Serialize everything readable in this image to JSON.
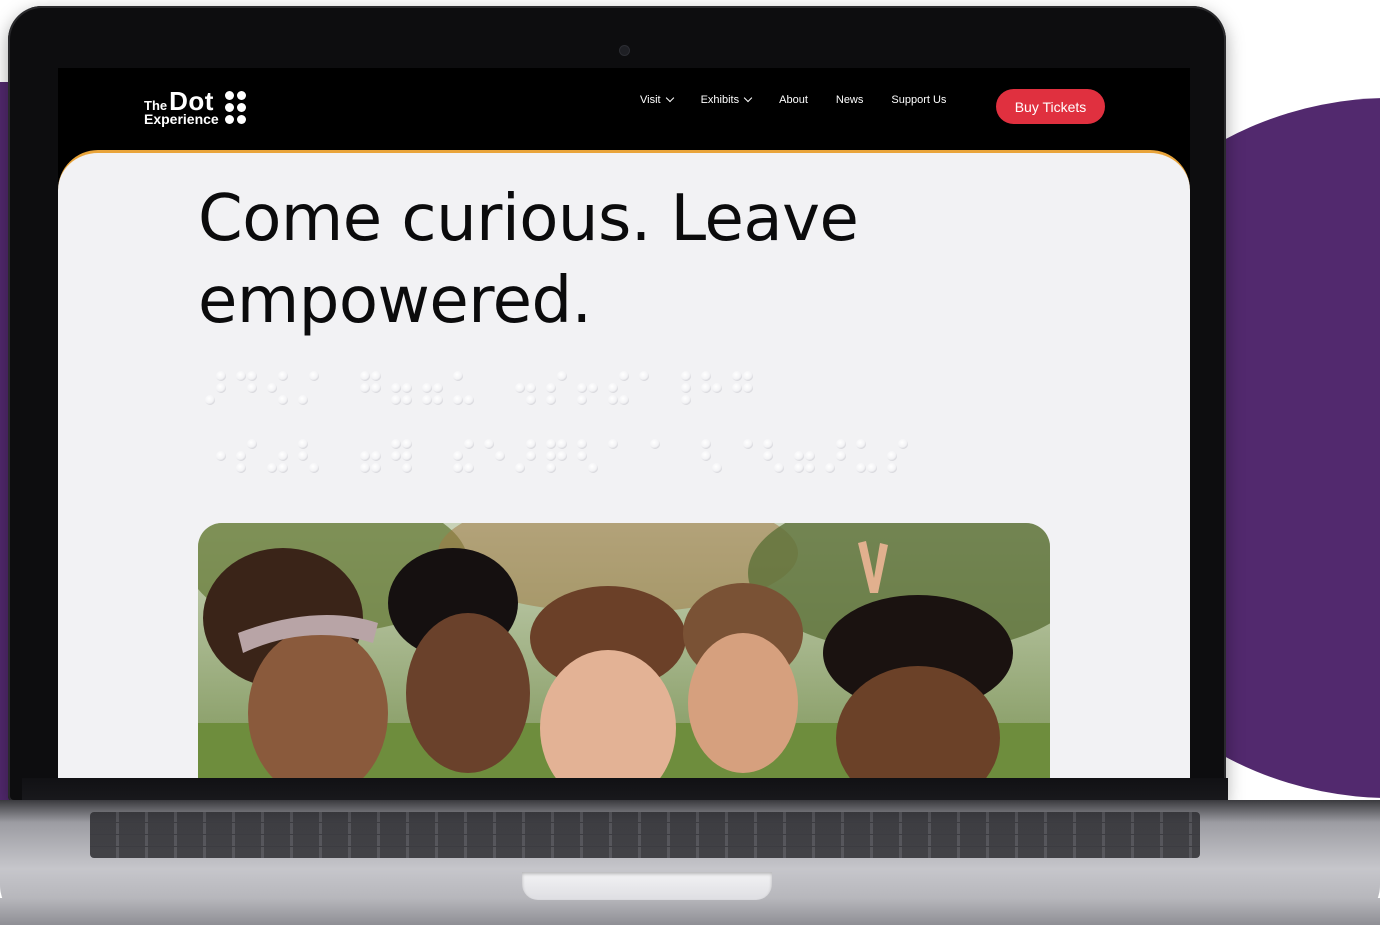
{
  "site": {
    "logo": {
      "the": "The",
      "dot": "Dot",
      "experience": "Experience"
    },
    "nav": {
      "items": [
        {
          "label": "Visit",
          "dropdown": true
        },
        {
          "label": "Exhibits",
          "dropdown": true
        },
        {
          "label": "About",
          "dropdown": false
        },
        {
          "label": "News",
          "dropdown": false
        },
        {
          "label": "Support Us",
          "dropdown": false
        }
      ],
      "cta_label": "Buy Tickets"
    },
    "hero": {
      "headline": "Come curious. Leave empowered."
    }
  },
  "colors": {
    "brand_purple": "#52296e",
    "cta_red": "#e0303f",
    "accent_orange": "#e9a43a",
    "nav_black": "#000000",
    "page_bg": "#f2f2f4"
  }
}
